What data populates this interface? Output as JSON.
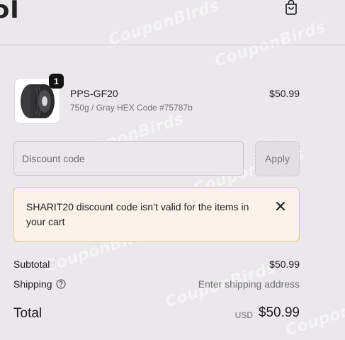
{
  "header": {
    "logo_partial": "ɔI"
  },
  "watermark": "CouponBirds",
  "cart_item": {
    "quantity": "1",
    "name": "PPS-GF20",
    "variant": "750g / Gray HEX Code #75787b",
    "price": "$50.99"
  },
  "discount": {
    "placeholder": "Discount code",
    "apply_label": "Apply",
    "error_message": "SHARIT20 discount code isn’t valid for the items in your cart"
  },
  "summary": {
    "subtotal_label": "Subtotal",
    "subtotal_value": "$50.99",
    "shipping_label": "Shipping",
    "shipping_value": "Enter shipping address",
    "total_label": "Total",
    "currency": "USD",
    "total_value": "$50.99"
  },
  "colors": {
    "background": "#ebe8ec",
    "error_bg": "#fbf3ea",
    "error_border": "#f0c884"
  }
}
